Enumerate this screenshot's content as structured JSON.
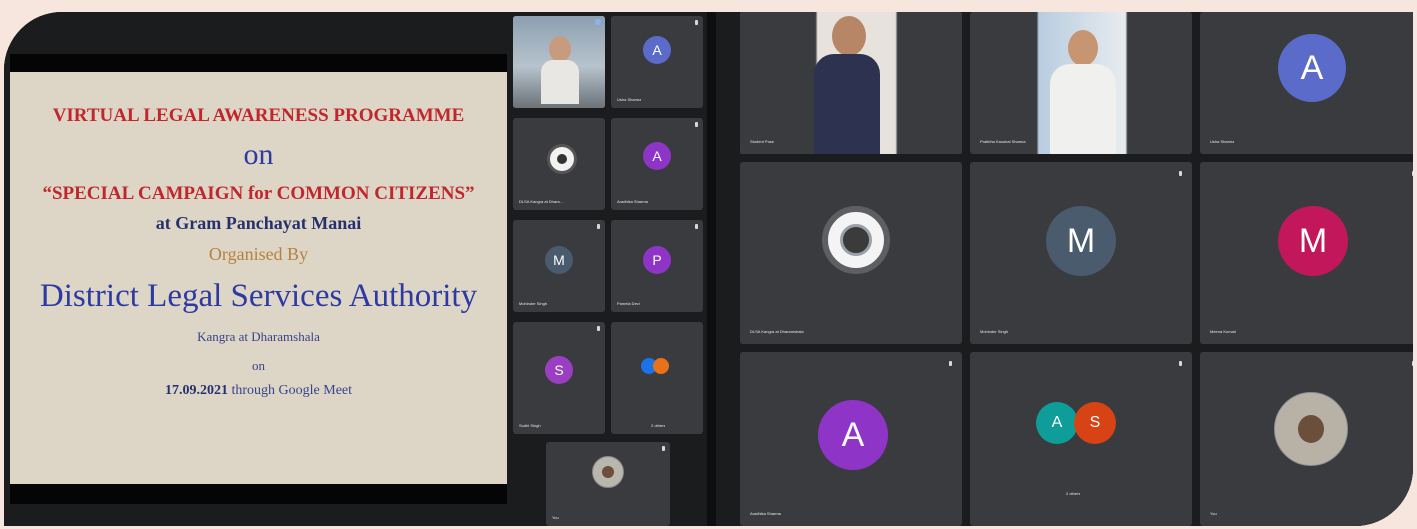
{
  "left_panel": {
    "slide": {
      "title": "VIRTUAL LEGAL AWARENESS PROGRAMME",
      "on": "on",
      "campaign": "“SPECIAL CAMPAIGN for COMMON CITIZENS”",
      "venue": "at Gram Panchayat Manai",
      "organised": "Organised By",
      "authority": "District Legal Services Authority",
      "location": "Kangra at Dharamshala",
      "on2": "on",
      "date": "17.09.2021",
      "date_suffix": " through Google Meet"
    },
    "tiles": [
      {
        "name": "",
        "letter": "",
        "color": ""
      },
      {
        "name": "Usha Sharma",
        "letter": "A",
        "color": "#5b6bc9"
      },
      {
        "name": "DLSA Kangra at Dhara…",
        "letter": "",
        "color": ""
      },
      {
        "name": "Aradhika Sharma",
        "letter": "A",
        "color": "#8e35c8"
      },
      {
        "name": "Mohinder Singh",
        "letter": "M",
        "color": "#4a5b6e"
      },
      {
        "name": "Pamela Devi",
        "letter": "P",
        "color": "#8e35c8"
      },
      {
        "name": "Sudhi Singh",
        "letter": "S",
        "color": "#9b3fc2"
      },
      {
        "name": "2 others",
        "letter": "",
        "color": ""
      },
      {
        "name": "You",
        "letter": "",
        "color": ""
      }
    ]
  },
  "right_panel": {
    "tiles": [
      {
        "name": "Student Pose",
        "letter": "",
        "color": ""
      },
      {
        "name": "Pratibha Kaushal Sharma",
        "letter": "",
        "color": ""
      },
      {
        "name": "Usha Sharma",
        "letter": "A",
        "color": "#5b6bc9"
      },
      {
        "name": "DLSA Kangra at Dharamshala",
        "letter": "",
        "color": ""
      },
      {
        "name": "Mohinder Singh",
        "letter": "M",
        "color": "#4a5b6e"
      },
      {
        "name": "Meena Kumari",
        "letter": "M",
        "color": "#c2185b"
      },
      {
        "name": "Aradhika Sharma",
        "letter": "A",
        "color": "#8e35c8"
      },
      {
        "name": "2 others",
        "letter": "A",
        "color": "#0f9d9a",
        "letter2": "S",
        "color2": "#d84315"
      },
      {
        "name": "You",
        "letter": "",
        "color": ""
      }
    ]
  }
}
